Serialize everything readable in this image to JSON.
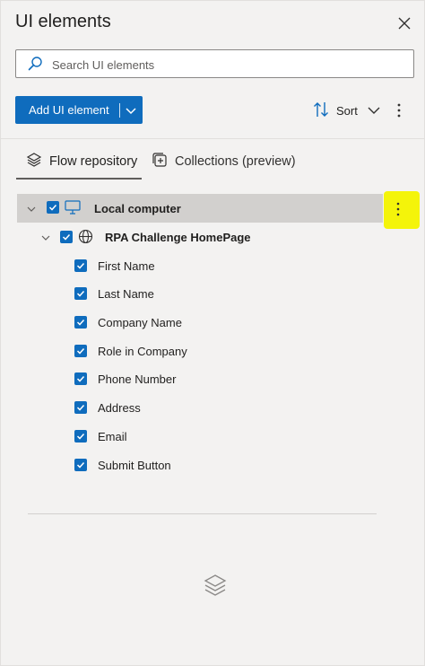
{
  "header": {
    "title": "UI elements",
    "close_icon": "close-icon"
  },
  "search": {
    "placeholder": "Search UI elements",
    "value": ""
  },
  "toolbar": {
    "add_label": "Add UI element",
    "sort_label": "Sort"
  },
  "tabs": [
    {
      "label": "Flow repository",
      "icon": "layers-icon",
      "selected": true
    },
    {
      "label": "Collections (preview)",
      "icon": "collection-add-icon",
      "selected": false
    }
  ],
  "tree": {
    "root": {
      "label": "Local computer",
      "icon": "monitor-icon",
      "checked": true,
      "expanded": true
    },
    "page": {
      "label": "RPA Challenge HomePage",
      "icon": "globe-icon",
      "checked": true,
      "expanded": true
    },
    "elements": [
      {
        "label": "First Name",
        "checked": true
      },
      {
        "label": "Last Name",
        "checked": true
      },
      {
        "label": "Company Name",
        "checked": true
      },
      {
        "label": "Role in Company",
        "checked": true
      },
      {
        "label": "Phone Number",
        "checked": true
      },
      {
        "label": "Address",
        "checked": true
      },
      {
        "label": "Email",
        "checked": true
      },
      {
        "label": "Submit Button",
        "checked": true
      }
    ]
  },
  "colors": {
    "accent": "#0f6cbd",
    "highlight": "#f4f40a",
    "selected_row": "#d2d0ce",
    "background": "#f3f2f1"
  }
}
